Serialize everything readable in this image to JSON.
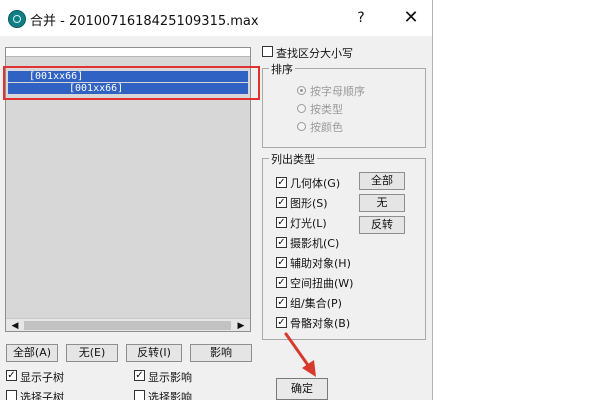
{
  "window": {
    "title": "合并 - 2010071618425109315.max",
    "help_label": "?",
    "close_label": "✕"
  },
  "object_list": {
    "rows": [
      "[001xx66]",
      "[001xx66]"
    ],
    "scroll_left": "◀",
    "scroll_right": "▶"
  },
  "list_buttons": {
    "all": "全部(A)",
    "none": "无(E)",
    "invert": "反转(I)",
    "influence": "影响"
  },
  "bottom_options": {
    "show_subtree": "显示子树",
    "select_subtree": "选择子树",
    "show_influence": "显示影响",
    "select_influence": "选择影响"
  },
  "case_sensitive": {
    "label": "查找区分大小写",
    "checked": false
  },
  "sort": {
    "title": "排序",
    "options": [
      "按字母顺序",
      "按类型",
      "按颜色"
    ],
    "selected": "按字母顺序"
  },
  "list_types": {
    "title": "列出类型",
    "items": [
      {
        "label": "几何体(G)",
        "checked": true
      },
      {
        "label": "图形(S)",
        "checked": true
      },
      {
        "label": "灯光(L)",
        "checked": true
      },
      {
        "label": "摄影机(C)",
        "checked": true
      },
      {
        "label": "辅助对象(H)",
        "checked": true
      },
      {
        "label": "空间扭曲(W)",
        "checked": true
      },
      {
        "label": "组/集合(P)",
        "checked": true
      },
      {
        "label": "骨骼对象(B)",
        "checked": true
      }
    ],
    "all_label": "全部",
    "none_label": "无",
    "invert_label": "反转"
  },
  "ok_button": {
    "label": "确定"
  },
  "colors": {
    "selection": "#2f62c2",
    "highlight_box": "#e13131",
    "arrow": "#d63a2e"
  }
}
